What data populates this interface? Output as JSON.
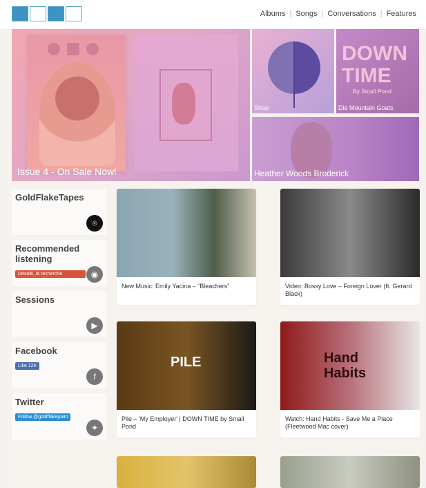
{
  "header": {
    "nav": [
      "Albums",
      "Songs",
      "Conversations",
      "Features"
    ]
  },
  "hero": {
    "main_caption": "Issue 4 - On Sale Now!",
    "shop_caption": "Shop",
    "down_title_line1": "DOWN",
    "down_title_line2": "TIME",
    "down_subtitle": "By Small Pond",
    "down_caption": "Die Mountain Goats",
    "heather_caption": "Heather Woods Broderick"
  },
  "sidebar": {
    "goldflake": "GoldFlakeTapes",
    "recommended": "Recommended listening",
    "recommended_button": "Désolé, la recherche",
    "sessions": "Sessions",
    "facebook": "Facebook",
    "facebook_like": "Like 12K",
    "twitter": "Twitter",
    "twitter_follow": "Follow @goldflakepaint"
  },
  "cards": [
    {
      "text": "New Music: Emily Yacina – “Bleachers”"
    },
    {
      "text": "Video: Bossy Love – Foreign Lover (ft. Gerard Black)"
    },
    {
      "text": "Pile – 'My Employer' | DOWN TIME by Small Pond",
      "image_text": "PILE"
    },
    {
      "text": "Watch: Hand Habits - Save Me a Place (Fleetwood Mac cover)",
      "image_text_line1": "Hand",
      "image_text_line2": "Habits"
    }
  ],
  "colors": {
    "accent": "#3d93c1",
    "hero_pink": "#f2a7b3",
    "purple": "#9f6ab8"
  }
}
